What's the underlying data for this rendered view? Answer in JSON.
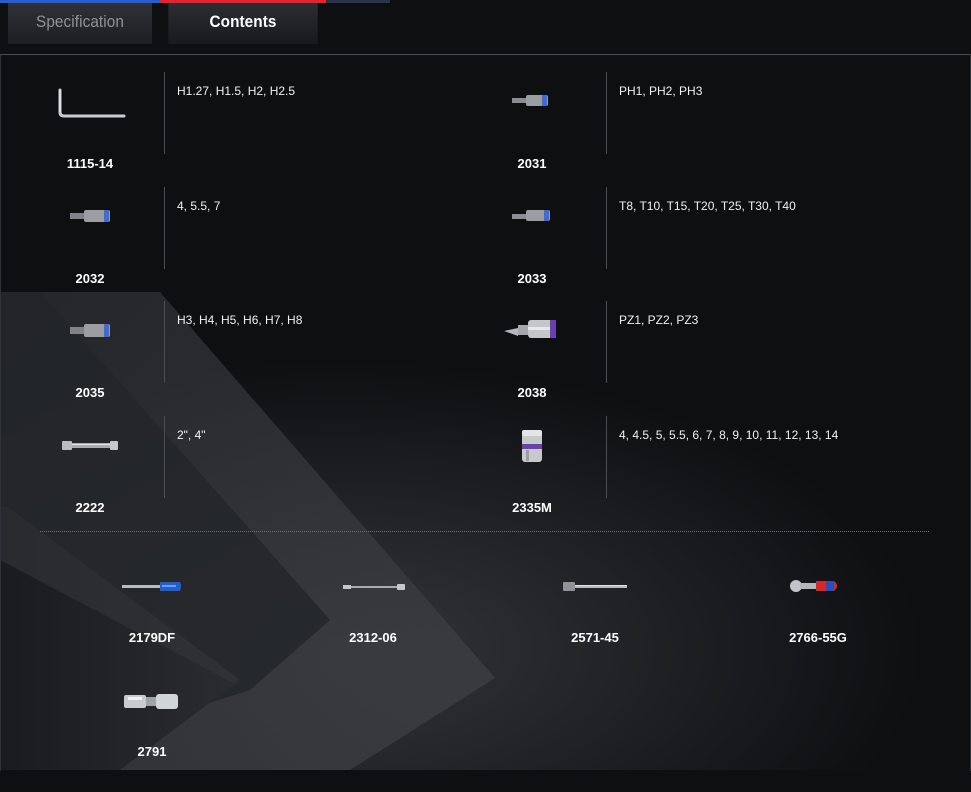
{
  "tabs": {
    "specification": "Specification",
    "contents": "Contents"
  },
  "items": [
    {
      "code": "1115-14",
      "sizes": "H1.27, H1.5, H2, H2.5",
      "icon": "hex-key-icon"
    },
    {
      "code": "2031",
      "sizes": "PH1, PH2, PH3",
      "icon": "bit-socket-icon"
    },
    {
      "code": "2032",
      "sizes": "4, 5.5, 7",
      "icon": "bit-socket-icon"
    },
    {
      "code": "2033",
      "sizes": "T8, T10, T15, T20, T25, T30, T40",
      "icon": "bit-socket-icon"
    },
    {
      "code": "2035",
      "sizes": "H3, H4, H5, H6, H7, H8",
      "icon": "bit-socket-icon"
    },
    {
      "code": "2038",
      "sizes": "PZ1, PZ2, PZ3",
      "icon": "pozidriv-socket-icon"
    },
    {
      "code": "2222",
      "sizes": "2\", 4\"",
      "icon": "extension-bar-icon"
    },
    {
      "code": "2335M",
      "sizes": "4, 4.5, 5, 5.5, 6, 7, 8, 9, 10, 11, 12, 13, 14",
      "icon": "socket-icon"
    }
  ],
  "tools": [
    {
      "code": "2179DF",
      "icon": "screwdriver-handle-icon"
    },
    {
      "code": "2312-06",
      "icon": "flexible-extension-icon"
    },
    {
      "code": "2571-45",
      "icon": "sliding-t-bar-icon"
    },
    {
      "code": "2766-55G",
      "icon": "ratchet-handle-icon"
    },
    {
      "code": "2791",
      "icon": "universal-joint-icon"
    }
  ],
  "colors": {
    "tab_accent_blue": "#2a5bd6",
    "tab_accent_red": "#e8212b",
    "background": "#0e0f11"
  }
}
